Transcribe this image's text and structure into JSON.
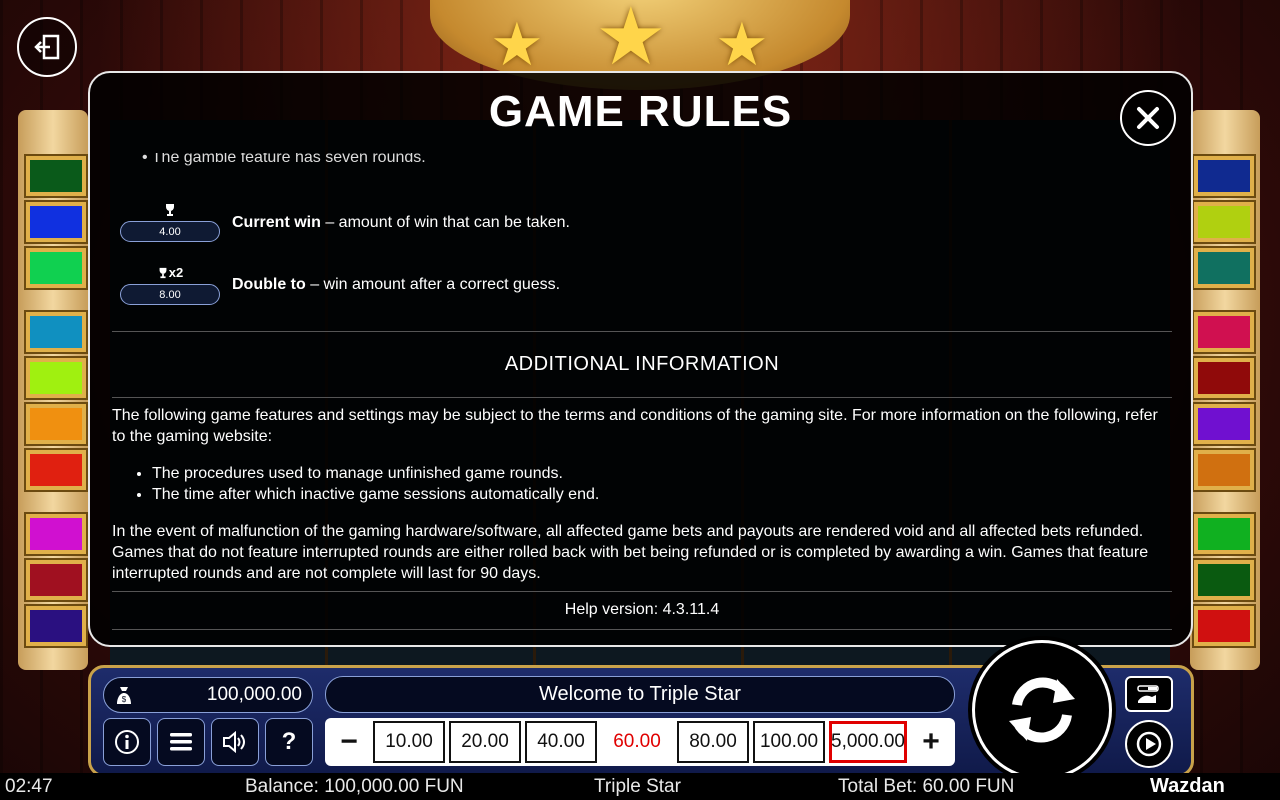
{
  "modal": {
    "title": "GAME RULES",
    "cut_bullet": "The gamble feature has seven rounds.",
    "current_win": {
      "value": "4.00",
      "term": "Current win",
      "desc": " – amount of win that can be taken."
    },
    "double_to": {
      "value": "8.00",
      "term": "Double to",
      "desc": " – win amount after a correct guess.",
      "icon_label": "x2"
    },
    "additional_title": "ADDITIONAL INFORMATION",
    "para1": "The following game features and settings may be subject to the terms and conditions of the gaming site. For more information on the following, refer to the gaming website:",
    "bullets": [
      "The procedures used to manage unfinished game rounds.",
      "The time after which inactive game sessions automatically end."
    ],
    "para2": "In the event of malfunction of the gaming hardware/software, all affected game bets and payouts are rendered void and all affected bets refunded. Games that do not feature interrupted rounds are either rolled back with bet being refunded or is completed by awarding a win. Games that feature interrupted rounds and are not complete will last for 90 days.",
    "help_version": "Help version: 4.3.11.4"
  },
  "panel": {
    "balance": "100,000.00",
    "welcome": "Welcome to Triple Star",
    "bets": [
      "10.00",
      "20.00",
      "40.00",
      "60.00",
      "80.00",
      "100.00",
      "5,000.00"
    ],
    "active_bet_index": 3,
    "minus": "−",
    "plus": "+"
  },
  "status": {
    "time": "02:47",
    "balance": "Balance: 100,000.00 FUN",
    "game_name": "Triple Star",
    "total_bet": "Total Bet: 60.00 FUN",
    "brand": "Wazdan"
  },
  "colors": {
    "active_bet": "#e00000",
    "panel_border": "#c9a24a",
    "left_gems": [
      "#0a5a1a",
      "#1030e0",
      "#10d050",
      "#1090c0",
      "#a0f010",
      "#f09010",
      "#e02010",
      "#d010d0",
      "#a01020",
      "#2a1080"
    ],
    "right_gems": [
      "#102a90",
      "#b0d010",
      "#107060",
      "#d01050",
      "#900a0a",
      "#7010d0",
      "#d07010",
      "#10b020",
      "#0a5a10",
      "#d01010"
    ]
  }
}
